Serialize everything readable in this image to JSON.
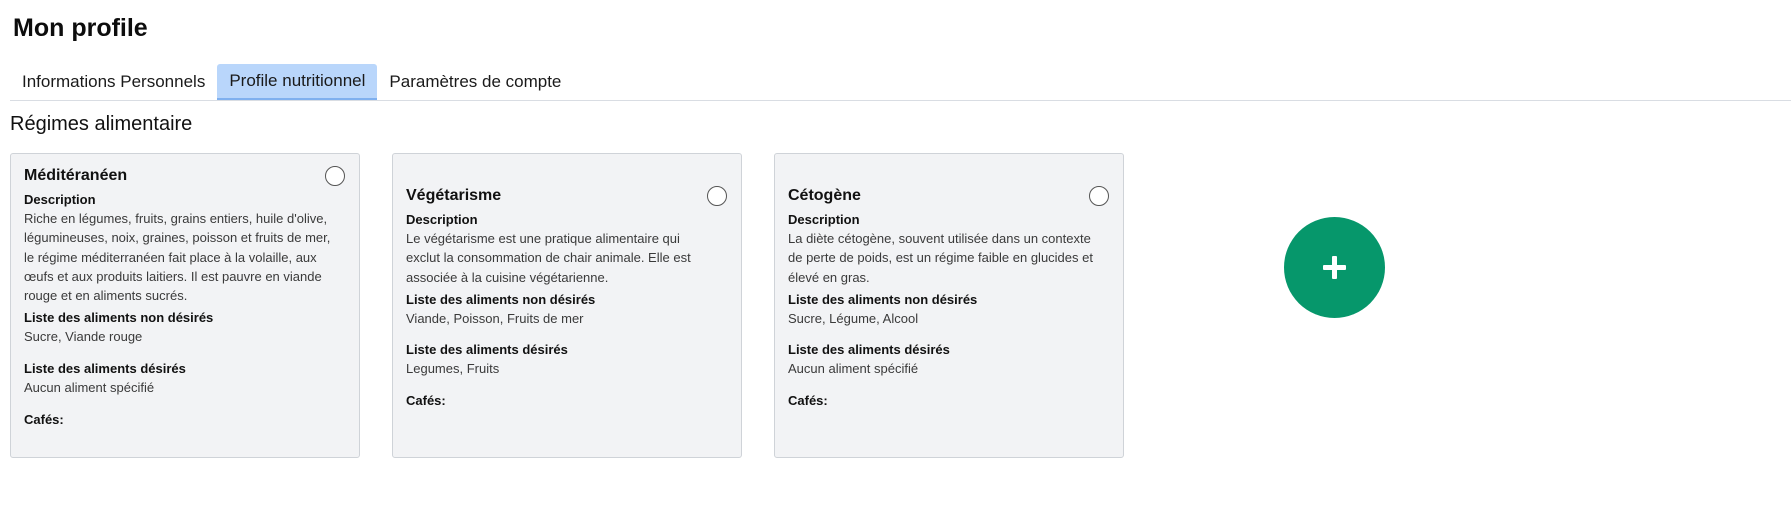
{
  "page": {
    "title": "Mon profile"
  },
  "tabs": [
    {
      "label": "Informations Personnels",
      "active": false
    },
    {
      "label": "Profile nutritionnel",
      "active": true
    },
    {
      "label": "Paramètres de compte",
      "active": false
    }
  ],
  "section": {
    "title": "Régimes alimentaire"
  },
  "labels": {
    "description": "Description",
    "unwanted": "Liste des aliments non désirés",
    "wanted": "Liste des aliments désirés",
    "cafes": "Cafés:"
  },
  "diets": [
    {
      "title": "Méditéranéen",
      "description_lines": [
        "Riche en légumes, fruits, grains entiers, huile d'olive,",
        "légumineuses, noix, graines, poisson et fruits de mer,",
        "le régime méditerranéen fait place à la volaille, aux",
        "œufs et aux produits laitiers. Il est pauvre en viande",
        "rouge et en aliments sucrés."
      ],
      "unwanted": "Sucre, Viande rouge",
      "wanted": "Aucun aliment spécifié",
      "selected": false
    },
    {
      "title": "Végétarisme",
      "description_lines": [
        "Le végétarisme est une pratique alimentaire qui",
        "exclut la consommation de chair animale. Elle est",
        "associée à la cuisine végétarienne."
      ],
      "unwanted": "Viande, Poisson, Fruits de mer",
      "wanted": "Legumes, Fruits",
      "selected": false
    },
    {
      "title": "Cétogène",
      "description_lines": [
        "La diète cétogène, souvent utilisée dans un contexte",
        "de perte de poids, est un régime faible en glucides et",
        "élevé en gras."
      ],
      "unwanted": "Sucre, Légume, Alcool",
      "wanted": "Aucun aliment spécifié",
      "selected": false
    }
  ],
  "add_button": {
    "icon": "plus-icon"
  },
  "colors": {
    "active_tab": "#b9d6fb",
    "card_bg": "#f2f3f5",
    "add_button": "#06976b"
  }
}
